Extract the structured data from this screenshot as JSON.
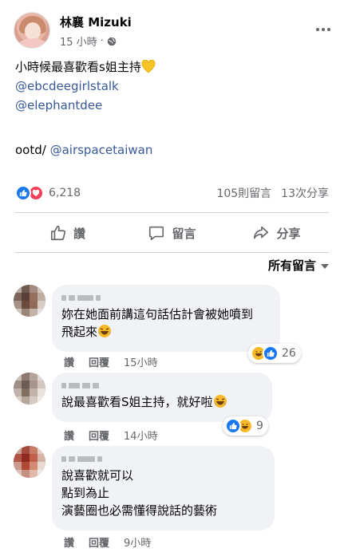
{
  "post": {
    "author": "林襄 Mizuki",
    "time": "15 小時",
    "visibility_icon": "globe-icon",
    "lines": [
      {
        "text": "小時候最喜歡看s姐主持",
        "emoji": "yellow-heart-icon"
      },
      {
        "link": "@ebcdeegirlstalk"
      },
      {
        "link": "@elephantdee"
      },
      {
        "text": ""
      },
      {
        "text": "ootd/ ",
        "link": "@airspacetaiwan"
      }
    ]
  },
  "stats": {
    "reaction_icons": [
      "like-icon",
      "love-icon"
    ],
    "reaction_count": "6,218",
    "comments": "105則留言",
    "shares": "13次分享"
  },
  "actions": {
    "like": "讚",
    "comment": "留言",
    "share": "分享"
  },
  "sort_label": "所有留言",
  "comments": [
    {
      "lines": [
        "妳在她面前講這句話估計會被她噴到",
        "飛起來"
      ],
      "emoji": "rolling-laughing-icon",
      "like_label": "讚",
      "reply_label": "回覆",
      "time": "15小時",
      "reactions": [
        "haha-icon",
        "like-icon"
      ],
      "reaction_count": "26"
    },
    {
      "lines": [
        "說最喜歡看S姐主持，就好啦"
      ],
      "emoji": "laughing-icon",
      "like_label": "讚",
      "reply_label": "回覆",
      "time": "14小時",
      "reactions": [
        "like-icon",
        "haha-icon"
      ],
      "reaction_count": "9"
    },
    {
      "lines": [
        "說喜歡就可以",
        "點到為止",
        "演藝圈也必需懂得說話的藝術"
      ],
      "like_label": "讚",
      "reply_label": "回覆",
      "time": "9小時"
    }
  ],
  "colors": {
    "link": "#385898",
    "like_blue": "#1877f2",
    "love_red": "#f33e58",
    "haha_yellow": "#f7b928",
    "bubble_bg": "#f0f2f5",
    "secondary_text": "#65676b"
  }
}
